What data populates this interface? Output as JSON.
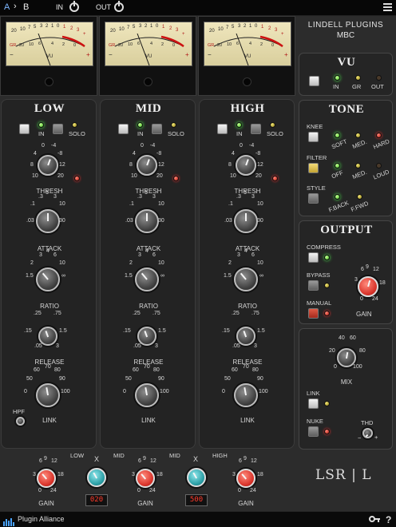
{
  "topbar": {
    "compare": "A",
    "compare_arrow": "›",
    "compare_b": "B",
    "in_label": "IN",
    "out_label": "OUT",
    "menu_icon": "hamburger-icon"
  },
  "brand": {
    "name_line1": "LINDELL PLUGINS",
    "name_line2": "MBC",
    "logo": "LSR | L"
  },
  "meters": {
    "scale_top": [
      "20",
      "10",
      "7",
      "5",
      "3",
      "2",
      "1",
      "0",
      "1",
      "2",
      "3",
      "+"
    ],
    "scale_bottom": [
      "GR",
      "20",
      "10",
      "6",
      "4",
      "2",
      "0"
    ],
    "unit": "VU",
    "minus": "−",
    "plus": "+"
  },
  "channels": [
    {
      "title": "LOW",
      "in": "IN",
      "solo": "SOLO",
      "thresh": "THRESH",
      "attack": "ATTACK",
      "ratio": "RATIO",
      "release": "RELEASE",
      "link": "LINK",
      "thresh_ticks": [
        "0",
        "-4",
        "4",
        "-8",
        "8",
        "12",
        "10",
        "20"
      ],
      "attack_ticks": [
        ".3",
        "1",
        "3",
        ".1",
        "10",
        ".03",
        "30"
      ],
      "ratio_ticks": [
        "3",
        "4",
        "6",
        "2",
        "10",
        "1.5",
        "∞"
      ],
      "release_ticks": [
        ".25",
        ".75",
        ".15",
        "1.5",
        ".05",
        "3"
      ],
      "link_ticks": [
        "60",
        "70",
        "80",
        "50",
        "90",
        "0",
        "100"
      ],
      "hpf": "HPF"
    },
    {
      "title": "MID",
      "in": "IN",
      "solo": "SOLO",
      "thresh": "THRESH",
      "attack": "ATTACK",
      "ratio": "RATIO",
      "release": "RELEASE",
      "link": "LINK",
      "thresh_ticks": [
        "0",
        "-4",
        "4",
        "-8",
        "8",
        "12",
        "10",
        "20"
      ],
      "attack_ticks": [
        ".3",
        "1",
        "3",
        ".1",
        "10",
        ".03",
        "30"
      ],
      "ratio_ticks": [
        "3",
        "4",
        "6",
        "2",
        "10",
        "1.5",
        "∞"
      ],
      "release_ticks": [
        ".25",
        ".75",
        ".15",
        "1.5",
        ".05",
        "3"
      ],
      "link_ticks": [
        "60",
        "70",
        "80",
        "50",
        "90",
        "0",
        "100"
      ],
      "hpf": ""
    },
    {
      "title": "HIGH",
      "in": "IN",
      "solo": "SOLO",
      "thresh": "THRESH",
      "attack": "ATTACK",
      "ratio": "RATIO",
      "release": "RELEASE",
      "link": "LINK",
      "thresh_ticks": [
        "0",
        "-4",
        "4",
        "-8",
        "8",
        "12",
        "10",
        "20"
      ],
      "attack_ticks": [
        ".3",
        "1",
        "3",
        ".1",
        "10",
        ".03",
        "30"
      ],
      "ratio_ticks": [
        "3",
        "4",
        "6",
        "2",
        "10",
        "1.5",
        "∞"
      ],
      "release_ticks": [
        ".25",
        ".75",
        ".15",
        "1.5",
        ".05",
        "3"
      ],
      "link_ticks": [
        "60",
        "70",
        "80",
        "50",
        "90",
        "0",
        "100"
      ],
      "hpf": ""
    }
  ],
  "vu_panel": {
    "title": "VU",
    "in": "IN",
    "gr": "GR",
    "out": "OUT"
  },
  "tone": {
    "title": "TONE",
    "knee": "KNEE",
    "knee_opts": [
      "SOFT",
      "MED.",
      "HARD"
    ],
    "filter": "FILTER",
    "filter_opts": [
      "OFF",
      "MED.",
      "LOUD"
    ],
    "style": "STYLE",
    "style_opts": [
      "F.BACK",
      "F.FWD"
    ]
  },
  "output": {
    "title": "OUTPUT",
    "compress": "COMPRESS",
    "bypass": "BYPASS",
    "manual": "MANUAL",
    "gain": "GAIN",
    "gain_ticks": [
      "6",
      "9",
      "12",
      "3",
      "18",
      "0",
      "24"
    ]
  },
  "mix": {
    "label": "MIX",
    "ticks": [
      "40",
      "60",
      "20",
      "80",
      "0",
      "100"
    ],
    "link": "LINK",
    "nuke": "NUKE",
    "thd": "THD",
    "thd_minus": "−",
    "thd_plus": "+"
  },
  "bottom": {
    "gain": "GAIN",
    "gain_ticks": [
      "6",
      "9",
      "12",
      "3",
      "18",
      "0",
      "24"
    ],
    "x1_labels": [
      "LOW",
      "X",
      "MID"
    ],
    "x2_labels": [
      "MID",
      "X",
      "HIGH"
    ],
    "x1_value": "020",
    "x2_value": "500"
  },
  "footer": {
    "brand": "Plugin Alliance",
    "key_icon": "key-icon",
    "help": "?"
  },
  "colors": {
    "accent_red": "#d9332a",
    "teal": "#2a9ea5",
    "led_green": "#3bbd1a"
  }
}
